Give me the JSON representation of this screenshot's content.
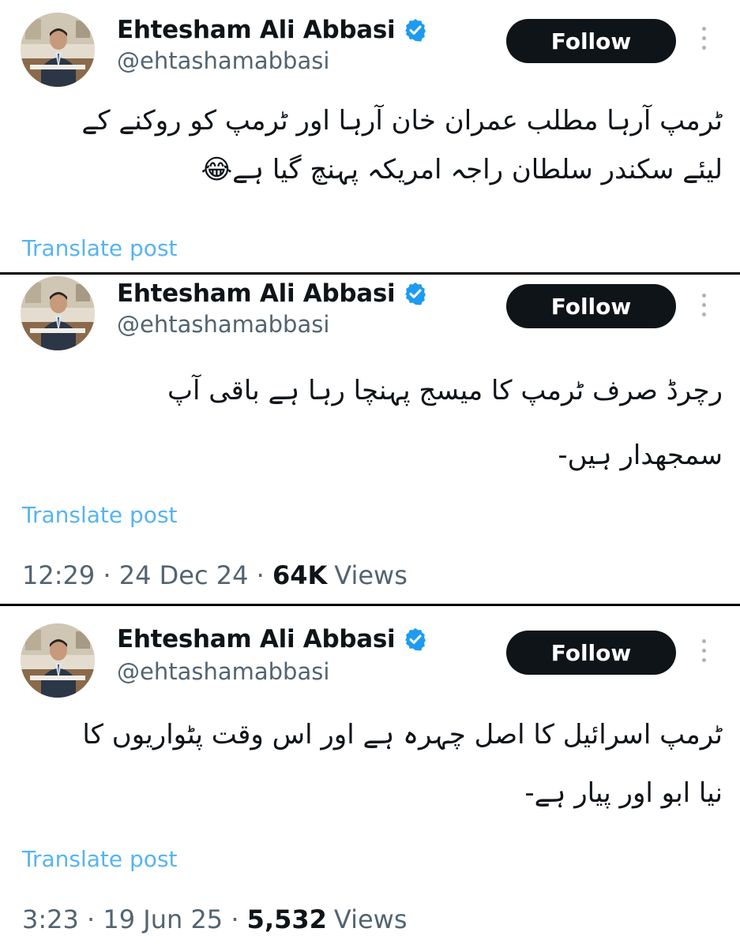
{
  "tweets": [
    {
      "display_name": "Ehtesham Ali Abbasi",
      "handle": "@ehtashamabbasi",
      "follow_label": "Follow",
      "text_lines": [
        "ٹرمپ آرہا مطلب عمران خان آرہا اور ٹرمپ کو روکنے کے",
        "لیئے سکندر سلطان راجہ امریکہ پہنچ گیا ہے😂"
      ],
      "translate_label": "Translate post"
    },
    {
      "display_name": "Ehtesham Ali Abbasi",
      "handle": "@ehtashamabbasi",
      "follow_label": "Follow",
      "text_lines": [
        "رچرڈ صرف ٹرمپ کا میسج پہنچا رہا ہے باقی آپ",
        "سمجھدار ہیں-"
      ],
      "translate_label": "Translate post",
      "time": "12:29",
      "date": "24 Dec 24",
      "views_count": "64K",
      "views_label": "Views"
    },
    {
      "display_name": "Ehtesham Ali Abbasi",
      "handle": "@ehtashamabbasi",
      "follow_label": "Follow",
      "text_lines": [
        "ٹرمپ اسرائیل کا اصل چہرہ ہے اور اس وقت پٹواریوں کا",
        "نیا ابو اور پیار ہے-"
      ],
      "translate_label": "Translate post",
      "time": "3:23",
      "date": "19 Jun 25",
      "views_count": "5,532",
      "views_label": "Views"
    }
  ],
  "separator": " · ",
  "icons": {
    "verified": "verified-badge-icon",
    "more": "more-options-icon"
  },
  "colors": {
    "verified_blue": "#1d9bf0",
    "follow_bg": "#0f1419",
    "follow_text": "#ffffff",
    "link": "#1d9bf0",
    "secondary_text": "#536471",
    "divider": "#000000"
  }
}
